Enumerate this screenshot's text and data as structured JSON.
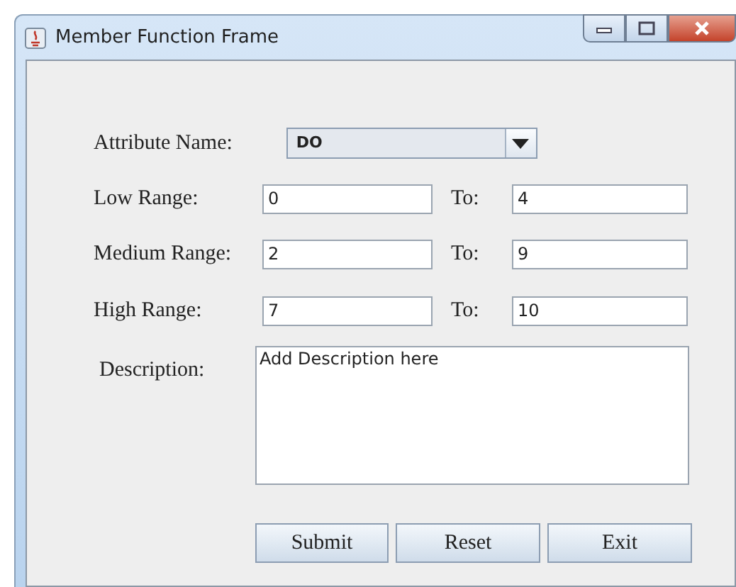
{
  "window": {
    "title": "Member Function Frame"
  },
  "attribute": {
    "label": "Attribute Name:",
    "value": "DO"
  },
  "ranges": [
    {
      "label": "Low Range:",
      "from": "0",
      "to_label": "To:",
      "to": "4"
    },
    {
      "label": "Medium Range:",
      "from": "2",
      "to_label": "To:",
      "to": "9"
    },
    {
      "label": "High Range:",
      "from": "7",
      "to_label": "To:",
      "to": "10"
    }
  ],
  "description": {
    "label": "Description:",
    "value": "Add Description here"
  },
  "buttons": [
    "Submit",
    "Reset",
    "Exit"
  ]
}
